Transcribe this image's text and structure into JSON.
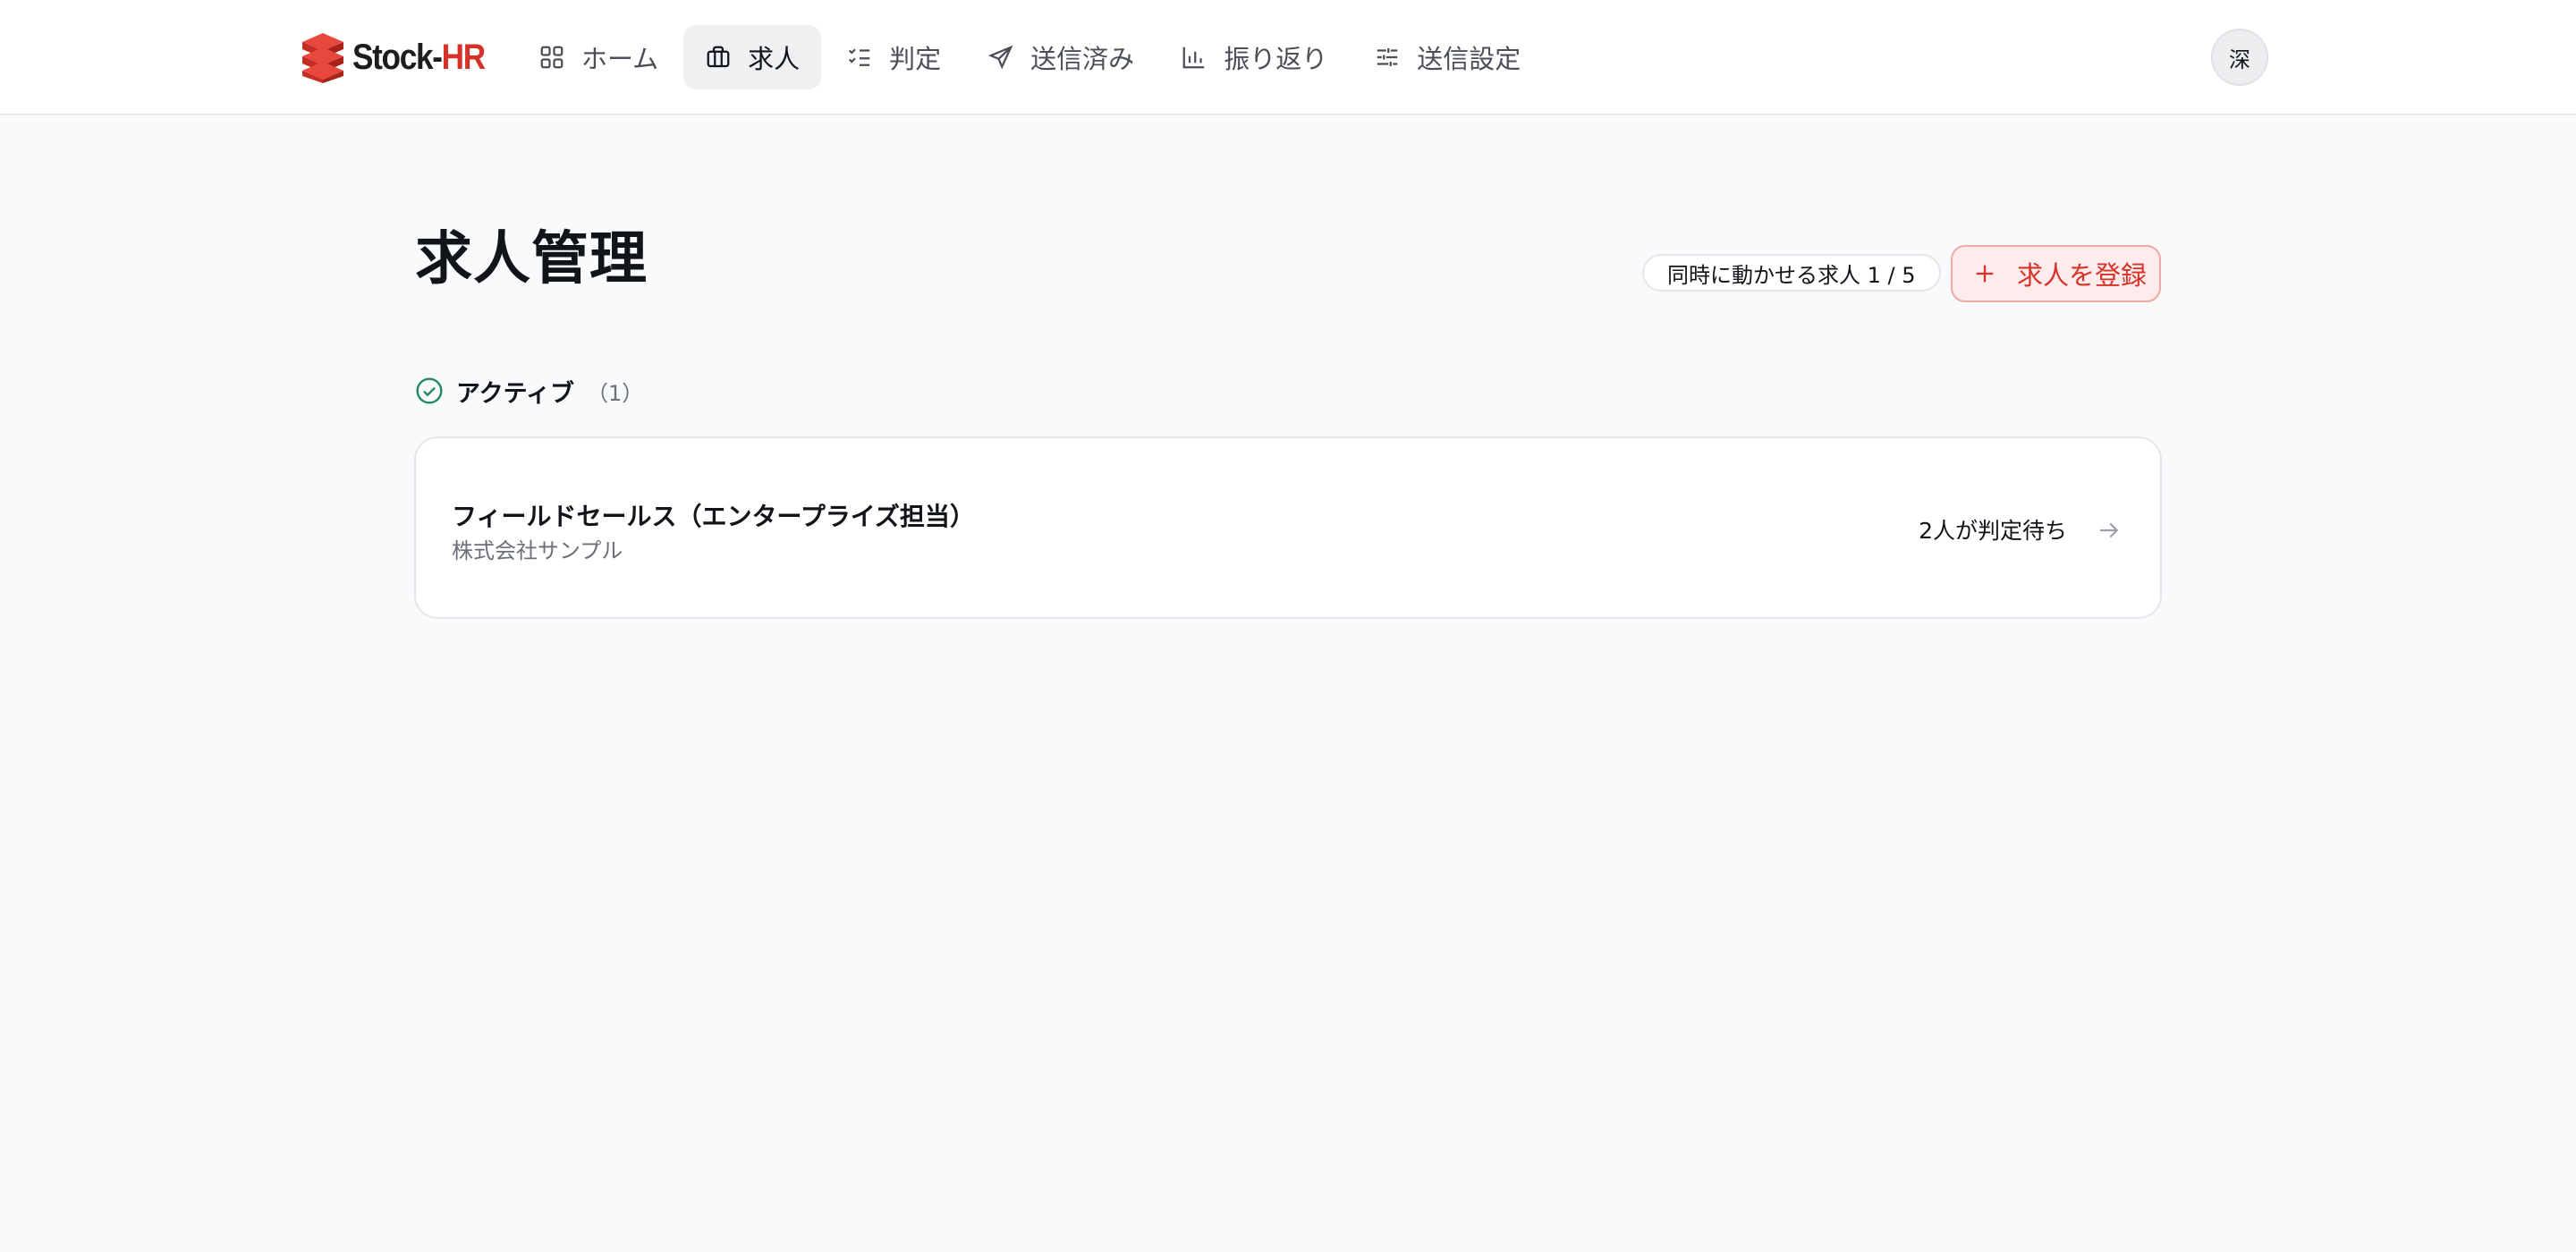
{
  "brand": {
    "name_part1": "Stock-",
    "name_part2": "HR",
    "accent_color": "#d6322a"
  },
  "nav": {
    "items": [
      {
        "label": "ホーム",
        "icon": "dashboard-icon"
      },
      {
        "label": "求人",
        "icon": "briefcase-icon",
        "active": true
      },
      {
        "label": "判定",
        "icon": "checklist-icon"
      },
      {
        "label": "送信済み",
        "icon": "send-icon"
      },
      {
        "label": "振り返り",
        "icon": "bar-chart-icon"
      },
      {
        "label": "送信設定",
        "icon": "sliders-icon"
      }
    ]
  },
  "user": {
    "avatar_initial": "深"
  },
  "page": {
    "title": "求人管理",
    "quota_label": "同時に動かせる求人 1 / 5",
    "add_button_label": "求人を登録"
  },
  "sections": {
    "active": {
      "label": "アクティブ",
      "count": "（1）",
      "status_color": "#1f8a5b",
      "jobs": [
        {
          "title": "フィールドセールス（エンタープライズ担当）",
          "company": "株式会社サンプル",
          "status": "2人が判定待ち"
        }
      ]
    }
  }
}
